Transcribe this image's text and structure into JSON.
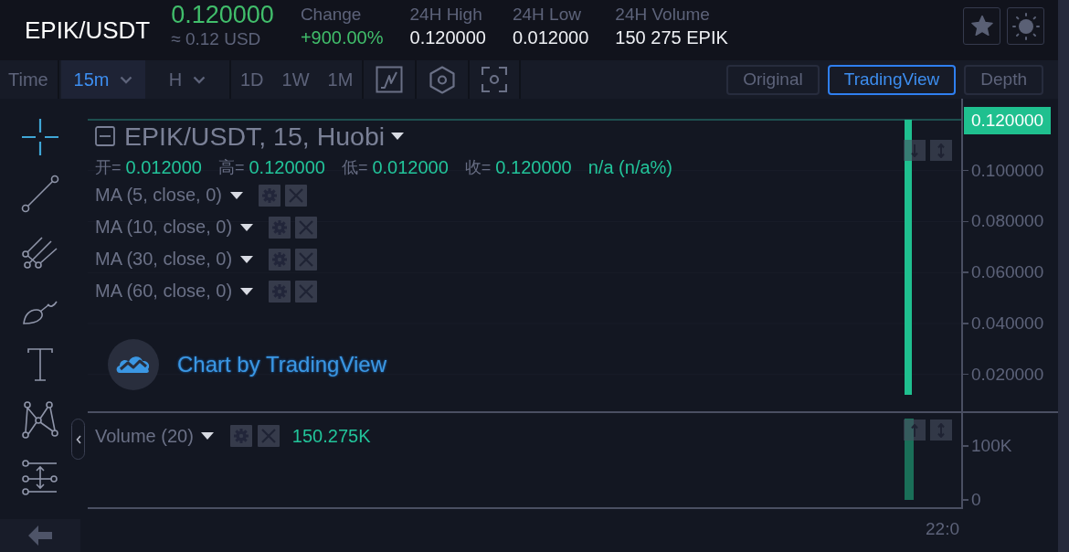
{
  "header": {
    "pair": "EPIK/USDT",
    "price": "0.120000",
    "price_usd": "≈ 0.12 USD",
    "stats": [
      {
        "label": "Change",
        "value": "+900.00%",
        "kind": "change"
      },
      {
        "label": "24H High",
        "value": "0.120000",
        "kind": "plain"
      },
      {
        "label": "24H Low",
        "value": "0.012000",
        "kind": "plain"
      },
      {
        "label": "24H Volume",
        "value": "150 275 EPIK",
        "kind": "plain"
      }
    ]
  },
  "toolbar": {
    "time_label": "Time",
    "intervals": [
      {
        "label": "15m",
        "selected": true,
        "dropdown": true
      },
      {
        "label": "H",
        "selected": false,
        "dropdown": true
      },
      {
        "label": "1D",
        "selected": false,
        "dropdown": false
      },
      {
        "label": "1W",
        "selected": false,
        "dropdown": false
      },
      {
        "label": "1M",
        "selected": false,
        "dropdown": false
      }
    ],
    "views": [
      {
        "label": "Original",
        "selected": false
      },
      {
        "label": "TradingView",
        "selected": true
      },
      {
        "label": "Depth",
        "selected": false
      }
    ]
  },
  "tools": [
    {
      "kind": "crosshair",
      "selected": true
    },
    {
      "kind": "trend-line",
      "selected": false
    },
    {
      "kind": "pitchfork",
      "selected": false
    },
    {
      "kind": "brush",
      "selected": false
    },
    {
      "kind": "text",
      "selected": false
    },
    {
      "kind": "pattern",
      "selected": false
    },
    {
      "kind": "measure",
      "selected": false
    }
  ],
  "price_pane": {
    "legend": {
      "title": "EPIK/USDT, 15, Huobi",
      "ohlc": [
        {
          "label": "开=",
          "value": "0.012000"
        },
        {
          "label": "高=",
          "value": "0.120000"
        },
        {
          "label": "低=",
          "value": "0.012000"
        },
        {
          "label": "收=",
          "value": "0.120000"
        }
      ],
      "change": "n/a (n/a%)"
    },
    "indicators": [
      "MA (5, close, 0)",
      "MA (10, close, 0)",
      "MA (30, close, 0)",
      "MA (60, close, 0)"
    ],
    "attribution": "Chart by TradingView",
    "last_price": "0.120000",
    "chart_data": {
      "type": "bar",
      "ylim": [
        0.012,
        0.12
      ],
      "yticks": [
        {
          "value": 0.1,
          "label": "0.100000"
        },
        {
          "value": 0.08,
          "label": "0.080000"
        },
        {
          "value": 0.06,
          "label": "0.060000"
        },
        {
          "value": 0.04,
          "label": "0.040000"
        },
        {
          "value": 0.02,
          "label": "0.020000"
        }
      ],
      "series": [
        {
          "color": "#1fc08f",
          "values": [
            0.12
          ]
        }
      ]
    }
  },
  "volume_pane": {
    "legend": {
      "title": "Volume (20)",
      "value": "150.275K"
    },
    "chart_data": {
      "type": "bar",
      "categories": [
        "22:0"
      ],
      "ylim": [
        0,
        150275
      ],
      "yticks": [
        {
          "value": 100000,
          "label": "100K"
        },
        {
          "value": 0,
          "label": "0"
        }
      ],
      "series": [
        {
          "color": "#1a6f58",
          "values": [
            150275
          ]
        }
      ]
    }
  }
}
